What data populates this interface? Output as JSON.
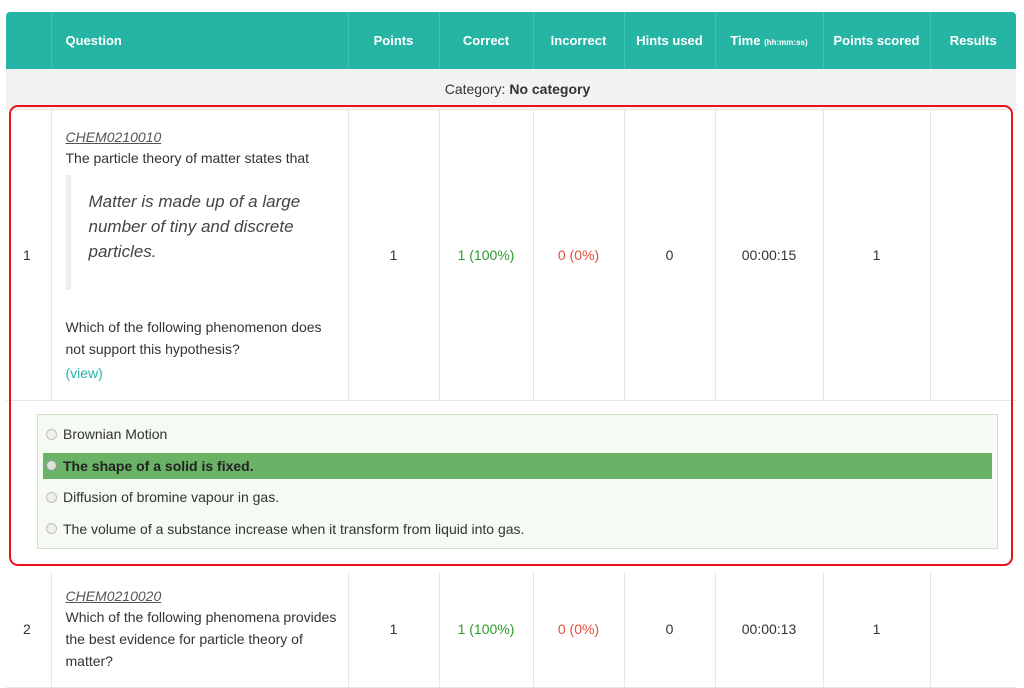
{
  "headers": {
    "num": "",
    "question": "Question",
    "points": "Points",
    "correct": "Correct",
    "incorrect": "Incorrect",
    "hints": "Hints used",
    "time": "Time",
    "time_unit": "(hh:mm:ss)",
    "scored": "Points scored",
    "results": "Results"
  },
  "category": {
    "label": "Category:",
    "value": "No category"
  },
  "rows": [
    {
      "num": "1",
      "id": "CHEM0210010",
      "intro": "The particle theory of matter states that",
      "quote": "Matter is made up of a large number of tiny and discrete particles.",
      "question": "Which of the following phenomenon does not support this hypothesis?",
      "view": "(view)",
      "points": "1",
      "correct": "1 (100%)",
      "incorrect": "0 (0%)",
      "hints": "0",
      "time": "00:00:15",
      "scored": "1",
      "results": "",
      "answers": [
        "Brownian Motion",
        "The shape of a solid is fixed.",
        "Diffusion of bromine vapour in gas.",
        "The volume of a substance increase when it transform from liquid into gas."
      ],
      "selected_answer": "The shape of a solid is fixed."
    },
    {
      "num": "2",
      "id": "CHEM0210020",
      "question": "Which of the following phenomena provides the best evidence for particle theory of matter?",
      "points": "1",
      "correct": "1 (100%)",
      "incorrect": "0 (0%)",
      "hints": "0",
      "time": "00:00:13",
      "scored": "1",
      "results": ""
    }
  ],
  "colors": {
    "header_bg": "#26b5a4",
    "correct": "#2e9a2e",
    "incorrect": "#e74c3c",
    "selected_answer_bg": "#6ab266",
    "highlight_border": "#e8131b"
  }
}
